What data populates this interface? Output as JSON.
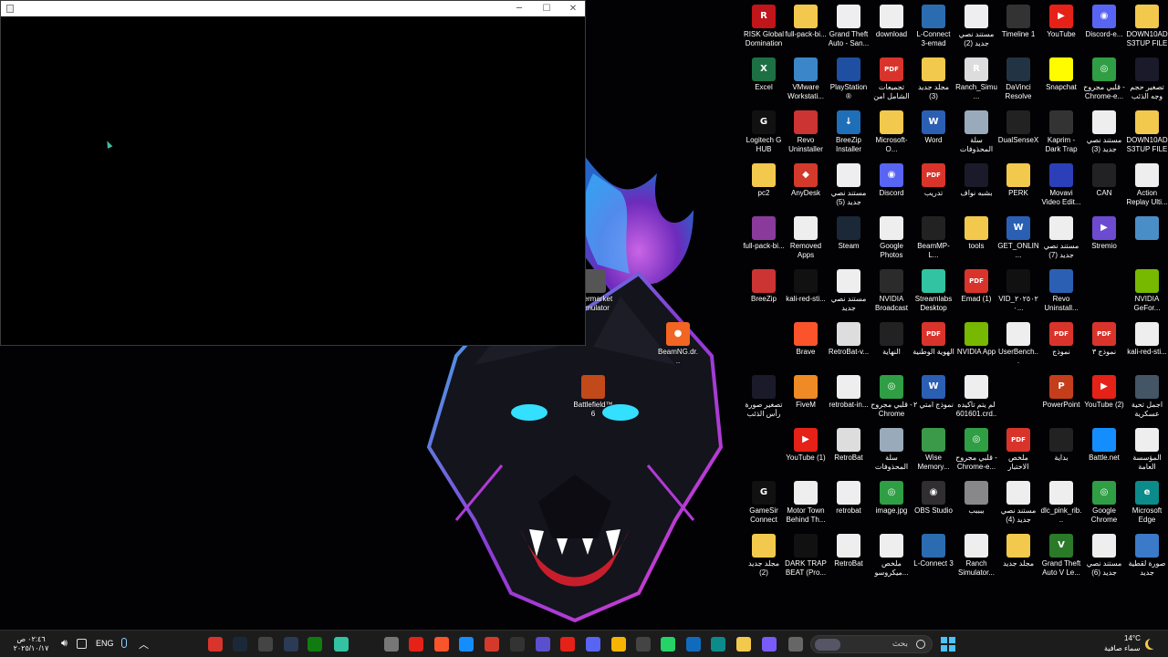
{
  "desktop": {
    "icons": [
      {
        "label": "RISK Global Domination",
        "color": "#c0151a",
        "glyph": "R"
      },
      {
        "label": "full-pack-bi...",
        "color": "#f2c94c",
        "glyph": ""
      },
      {
        "label": "Grand Theft Auto - San...",
        "color": "#eeeeee",
        "glyph": ""
      },
      {
        "label": "download",
        "color": "#eeeeee",
        "glyph": ""
      },
      {
        "label": "L-Connect 3-emad",
        "color": "#2b6cb0",
        "glyph": ""
      },
      {
        "label": "مستند نصي جديد (2)",
        "color": "#eeeeee",
        "glyph": ""
      },
      {
        "label": "Timeline 1",
        "color": "#333333",
        "glyph": ""
      },
      {
        "label": "YouTube",
        "color": "#e62117",
        "glyph": "▶"
      },
      {
        "label": "Discord-e...",
        "color": "#5865f2",
        "glyph": "◉"
      },
      {
        "label": "DOWN10AD S3TUP FILE ...",
        "color": "#f2c94c",
        "glyph": ""
      },
      {
        "label": "Excel",
        "color": "#1d7044",
        "glyph": "X"
      },
      {
        "label": "VMware Workstati...",
        "color": "#3a86c8",
        "glyph": ""
      },
      {
        "label": "PlayStation® Accessories",
        "color": "#1f4fa0",
        "glyph": ""
      },
      {
        "label": "تجميعات الشامل امن",
        "color": "#d9342b",
        "glyph": "PDF"
      },
      {
        "label": "مجلد جديد (3)",
        "color": "#f2c94c",
        "glyph": ""
      },
      {
        "label": "Ranch_Simu...",
        "color": "#dddddd",
        "glyph": "R"
      },
      {
        "label": "DaVinci Resolve",
        "color": "#223344",
        "glyph": ""
      },
      {
        "label": "Snapchat",
        "color": "#fffc00",
        "glyph": ""
      },
      {
        "label": "قلبي مجروح - Chrome-e...",
        "color": "#2f9e44",
        "glyph": "◎"
      },
      {
        "label": "تصغير حجم وجه الذئب",
        "color": "#1a1a2a",
        "glyph": ""
      },
      {
        "label": "Logitech G HUB",
        "color": "#111111",
        "glyph": "G"
      },
      {
        "label": "Revo Uninstaller",
        "color": "#cc3333",
        "glyph": ""
      },
      {
        "label": "BreeZip Installer",
        "color": "#1f6fb8",
        "glyph": "↓"
      },
      {
        "label": "Microsoft-O...",
        "color": "#f2c94c",
        "glyph": ""
      },
      {
        "label": "Word",
        "color": "#2b5fb4",
        "glyph": "W"
      },
      {
        "label": "سلة المحذوفات",
        "color": "#9ab",
        "glyph": ""
      },
      {
        "label": "DualSenseX",
        "color": "#222222",
        "glyph": ""
      },
      {
        "label": "Kaprim - Dark Trap B...",
        "color": "#333333",
        "glyph": ""
      },
      {
        "label": "مستند نصي جديد (3)",
        "color": "#eeeeee",
        "glyph": ""
      },
      {
        "label": "DOWN10AD S3TUP FILE ...",
        "color": "#f2c94c",
        "glyph": ""
      },
      {
        "label": "pc2",
        "color": "#f2c94c",
        "glyph": ""
      },
      {
        "label": "AnyDesk",
        "color": "#d33a2c",
        "glyph": "◆"
      },
      {
        "label": "مستند نصي جديد (5)",
        "color": "#eeeeee",
        "glyph": ""
      },
      {
        "label": "Discord",
        "color": "#5865f2",
        "glyph": "◉"
      },
      {
        "label": "تدريب",
        "color": "#d9342b",
        "glyph": "PDF"
      },
      {
        "label": "بشبه نواف",
        "color": "#1a1a2a",
        "glyph": ""
      },
      {
        "label": "PERK",
        "color": "#f2c94c",
        "glyph": ""
      },
      {
        "label": "Movavi Video Edit...",
        "color": "#2a3fb8",
        "glyph": ""
      },
      {
        "label": "CAN",
        "color": "#222222",
        "glyph": ""
      },
      {
        "label": "Action Replay Ulti...",
        "color": "#eeeeee",
        "glyph": ""
      },
      {
        "label": "full-pack-bi...",
        "color": "#8a3a9a",
        "glyph": ""
      },
      {
        "label": "Removed Apps",
        "color": "#eeeeee",
        "glyph": ""
      },
      {
        "label": "Steam",
        "color": "#1b2838",
        "glyph": ""
      },
      {
        "label": "Google Photos",
        "color": "#eeeeee",
        "glyph": ""
      },
      {
        "label": "BeamMP-L...",
        "color": "#222222",
        "glyph": ""
      },
      {
        "label": "tools",
        "color": "#f2c94c",
        "glyph": ""
      },
      {
        "label": "GET_ONLIN...",
        "color": "#2b5fb4",
        "glyph": "W"
      },
      {
        "label": "مستند نصي جديد (7)",
        "color": "#eeeeee",
        "glyph": ""
      },
      {
        "label": "Stremio",
        "color": "#6c4bd1",
        "glyph": "▶"
      },
      {
        "label": "",
        "color": "#4a8ec8",
        "glyph": ""
      },
      {
        "label": "BreeZip",
        "color": "#c33",
        "glyph": ""
      },
      {
        "label": "kali-red-sti...",
        "color": "#111111",
        "glyph": ""
      },
      {
        "label": "مستند نصي جديد",
        "color": "#eeeeee",
        "glyph": ""
      },
      {
        "label": "NVIDIA Broadcast",
        "color": "#2b2b2b",
        "glyph": ""
      },
      {
        "label": "Streamlabs Desktop",
        "color": "#31c3a2",
        "glyph": ""
      },
      {
        "label": "Emad (1)",
        "color": "#d9342b",
        "glyph": "PDF"
      },
      {
        "label": "VID_٢٠٢٥٠٢٠...",
        "color": "#111111",
        "glyph": ""
      },
      {
        "label": "Revo Uninstall...",
        "color": "#2b5fb4",
        "glyph": ""
      },
      {
        "label": "",
        "color": "#000000",
        "glyph": ""
      },
      {
        "label": "NVIDIA GeFor...",
        "color": "#76b900",
        "glyph": ""
      },
      {
        "label": "",
        "color": "#000000",
        "glyph": ""
      },
      {
        "label": "Brave",
        "color": "#fb542b",
        "glyph": ""
      },
      {
        "label": "RetroBat-v...",
        "color": "#dddddd",
        "glyph": ""
      },
      {
        "label": "النهاية",
        "color": "#222222",
        "glyph": ""
      },
      {
        "label": "الهوية الوطنية",
        "color": "#d9342b",
        "glyph": "PDF"
      },
      {
        "label": "NVIDIA App",
        "color": "#76b900",
        "glyph": ""
      },
      {
        "label": "UserBench...",
        "color": "#eeeeee",
        "glyph": ""
      },
      {
        "label": "نموذج",
        "color": "#d9342b",
        "glyph": "PDF"
      },
      {
        "label": "نموذج ٣",
        "color": "#d9342b",
        "glyph": "PDF"
      },
      {
        "label": "kali-red-sti...",
        "color": "#eeeeee",
        "glyph": ""
      },
      {
        "label": "تصغير صورة رأس الذئب",
        "color": "#1a1a2a",
        "glyph": ""
      },
      {
        "label": "FiveM",
        "color": "#f08a24",
        "glyph": ""
      },
      {
        "label": "retrobat-in...",
        "color": "#eeeeee",
        "glyph": ""
      },
      {
        "label": "قلبي مجروح - Chrome",
        "color": "#2f9e44",
        "glyph": "◎"
      },
      {
        "label": "نموذج امتي ٢",
        "color": "#2b5fb4",
        "glyph": "W"
      },
      {
        "label": "لم يتم تأكيده 601601.crd...",
        "color": "#eeeeee",
        "glyph": ""
      },
      {
        "label": "",
        "color": "#000000",
        "glyph": ""
      },
      {
        "label": "PowerPoint",
        "color": "#c43e1c",
        "glyph": "P"
      },
      {
        "label": "YouTube (2)",
        "color": "#e62117",
        "glyph": "▶"
      },
      {
        "label": "اجمل تحية عسكرية",
        "color": "#445566",
        "glyph": ""
      },
      {
        "label": "",
        "color": "#000000",
        "glyph": ""
      },
      {
        "label": "YouTube (1)",
        "color": "#e62117",
        "glyph": "▶"
      },
      {
        "label": "RetroBat",
        "color": "#dddddd",
        "glyph": ""
      },
      {
        "label": "سلة المحذوفات",
        "color": "#9ab",
        "glyph": ""
      },
      {
        "label": "Wise Memory...",
        "color": "#3a9a4a",
        "glyph": ""
      },
      {
        "label": "قلبي مجروح - Chrome-e...",
        "color": "#2f9e44",
        "glyph": "◎"
      },
      {
        "label": "ملخص الاختبار الشامل",
        "color": "#d9342b",
        "glyph": "PDF"
      },
      {
        "label": "بداية",
        "color": "#222222",
        "glyph": ""
      },
      {
        "label": "Battle.net",
        "color": "#148eff",
        "glyph": ""
      },
      {
        "label": "المؤسسة العامة",
        "color": "#eeeeee",
        "glyph": ""
      },
      {
        "label": "GameSir Connect",
        "color": "#111111",
        "glyph": "G"
      },
      {
        "label": "Motor Town Behind Th...",
        "color": "#eeeeee",
        "glyph": ""
      },
      {
        "label": "retrobat",
        "color": "#eeeeee",
        "glyph": ""
      },
      {
        "label": "image.jpg",
        "color": "#2f9e44",
        "glyph": "◎"
      },
      {
        "label": "OBS Studio",
        "color": "#302e31",
        "glyph": "◉"
      },
      {
        "label": "ببببب",
        "color": "#888888",
        "glyph": ""
      },
      {
        "label": "مستند نصي جديد (4)",
        "color": "#eeeeee",
        "glyph": ""
      },
      {
        "label": "dlc_pink_rib...",
        "color": "#eeeeee",
        "glyph": ""
      },
      {
        "label": "Google Chrome",
        "color": "#2f9e44",
        "glyph": "◎"
      },
      {
        "label": "Microsoft Edge",
        "color": "#0c8b8b",
        "glyph": "e"
      },
      {
        "label": "مجلد جديد (2)",
        "color": "#f2c94c",
        "glyph": ""
      },
      {
        "label": "DARK TRAP BEAT (Pro...",
        "color": "#111111",
        "glyph": ""
      },
      {
        "label": "RetroBat",
        "color": "#eeeeee",
        "glyph": ""
      },
      {
        "label": "ملخص ميكروسو...",
        "color": "#eeeeee",
        "glyph": ""
      },
      {
        "label": "L-Connect 3",
        "color": "#2b6cb0",
        "glyph": ""
      },
      {
        "label": "Ranch Simulator...",
        "color": "#eeeeee",
        "glyph": ""
      },
      {
        "label": "مجلد جديد",
        "color": "#f2c94c",
        "glyph": ""
      },
      {
        "label": "Grand Theft Auto V Le...",
        "color": "#2a7a2a",
        "glyph": "V"
      },
      {
        "label": "مستند نصي جديد (6)",
        "color": "#eeeeee",
        "glyph": ""
      },
      {
        "label": "صورة لقطية جديد",
        "color": "#3a7ac8",
        "glyph": ""
      }
    ],
    "left_icons": [
      {
        "label": "upermarket Simulator",
        "color": "#555555",
        "glyph": ""
      },
      {
        "label": "BeamNG.dr...",
        "color": "#f26522",
        "glyph": "●"
      },
      {
        "label": "Battlefield™ 6",
        "color": "#c24a1a",
        "glyph": ""
      }
    ]
  },
  "taskbar": {
    "clock_time": "٠٢:٤٦ ص",
    "clock_date": "٢٠٢٥/١٠/١٧",
    "language": "ENG",
    "search_placeholder": "بحث",
    "weather_temp": "14°C",
    "weather_desc": "سماء صافية",
    "apps": [
      {
        "name": "app-brave-pinned",
        "color": "#d9342b"
      },
      {
        "name": "app-steam",
        "color": "#1b2838"
      },
      {
        "name": "app-mask",
        "color": "#444"
      },
      {
        "name": "app-monitor",
        "color": "#2b3a55"
      },
      {
        "name": "app-xbox",
        "color": "#107c10"
      },
      {
        "name": "app-streamlabs",
        "color": "#31c3a2"
      },
      {
        "name": "app-store",
        "color": "#777"
      },
      {
        "name": "app-youtube",
        "color": "#e62117"
      },
      {
        "name": "app-brave",
        "color": "#fb542b"
      },
      {
        "name": "app-blue",
        "color": "#148eff"
      },
      {
        "name": "app-anydesk",
        "color": "#d33a2c"
      },
      {
        "name": "app-es",
        "color": "#333"
      },
      {
        "name": "app-purple",
        "color": "#5a4fcf"
      },
      {
        "name": "app-youtube-2",
        "color": "#e62117"
      },
      {
        "name": "app-discord",
        "color": "#5865f2"
      },
      {
        "name": "app-chrome",
        "color": "#f4b400"
      },
      {
        "name": "app-dots",
        "color": "#444"
      },
      {
        "name": "app-whatsapp",
        "color": "#25d366"
      },
      {
        "name": "app-outlook",
        "color": "#0f6cbd"
      },
      {
        "name": "app-edge",
        "color": "#0c8b8b"
      },
      {
        "name": "app-explorer",
        "color": "#f2c94c"
      },
      {
        "name": "app-copilot",
        "color": "#7a5af8"
      },
      {
        "name": "app-window",
        "color": "#666"
      }
    ]
  }
}
